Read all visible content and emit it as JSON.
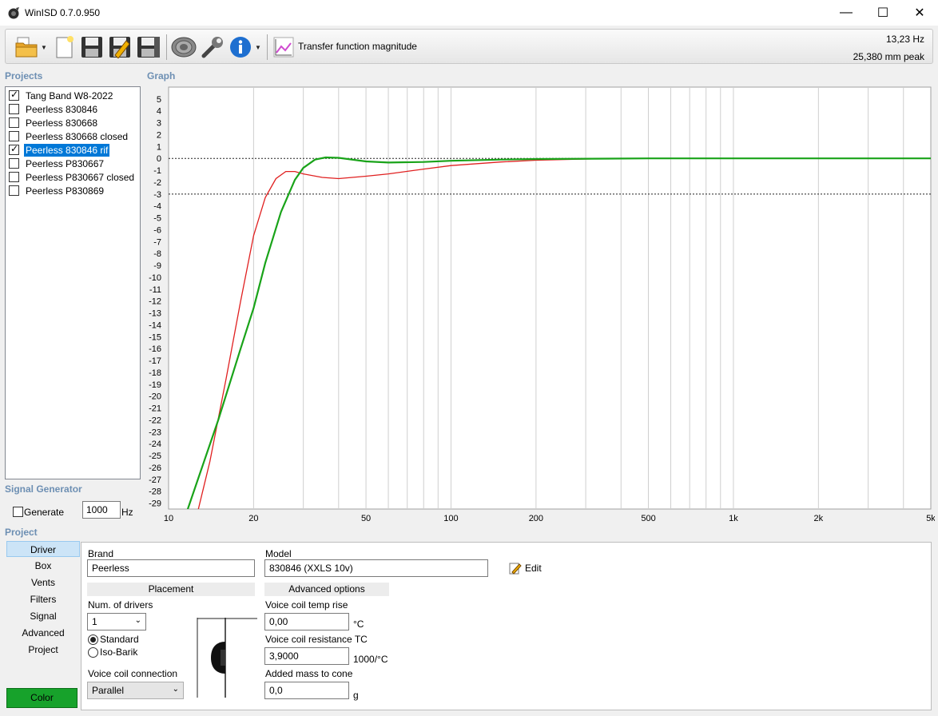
{
  "window": {
    "title": "WinISD 0.7.0.950",
    "minimize_glyph": "—",
    "maximize_glyph": "☐",
    "close_glyph": "✕"
  },
  "toolbar": {
    "icons": [
      "open-folder-icon",
      "new-document-icon",
      "save-icon",
      "save-as-icon",
      "save-all-icon",
      "driver-icon",
      "wrench-icon",
      "info-icon"
    ],
    "mode_icon": "chart-icon",
    "mode_label": "Transfer function magnitude",
    "cursor_frequency": "13,23 Hz",
    "cursor_excursion": "25,380 mm peak"
  },
  "projects": {
    "label": "Projects",
    "items": [
      {
        "name": "Tang Band W8-2022",
        "checked": true,
        "selected": false
      },
      {
        "name": "Peerless 830846",
        "checked": false,
        "selected": false
      },
      {
        "name": "Peerless 830668",
        "checked": false,
        "selected": false
      },
      {
        "name": "Peerless 830668 closed",
        "checked": false,
        "selected": false
      },
      {
        "name": "Peerless 830846 rif",
        "checked": true,
        "selected": true
      },
      {
        "name": "Peerless P830667",
        "checked": false,
        "selected": false
      },
      {
        "name": "Peerless P830667 closed",
        "checked": false,
        "selected": false
      },
      {
        "name": "Peerless P830869",
        "checked": false,
        "selected": false
      }
    ]
  },
  "signal_generator": {
    "label": "Signal Generator",
    "generate_label": "Generate",
    "generate_checked": false,
    "frequency": "1000",
    "unit": "Hz"
  },
  "graph": {
    "label": "Graph"
  },
  "chart_data": {
    "type": "line",
    "xscale": "log",
    "xlim": [
      10,
      5000
    ],
    "ylim": [
      -29.5,
      6
    ],
    "x_tick_labels": [
      "10",
      "20",
      "50",
      "100",
      "200",
      "500",
      "1k",
      "2k",
      "5k"
    ],
    "x_tick_values": [
      10,
      20,
      50,
      100,
      200,
      500,
      1000,
      2000,
      5000
    ],
    "y_tick_values": [
      5,
      4,
      3,
      2,
      1,
      0,
      -1,
      -2,
      -3,
      -4,
      -5,
      -6,
      -7,
      -8,
      -9,
      -10,
      -11,
      -12,
      -13,
      -14,
      -15,
      -16,
      -17,
      -18,
      -19,
      -20,
      -21,
      -22,
      -23,
      -24,
      -25,
      -26,
      -27,
      -28,
      -29
    ],
    "reference_lines": [
      0,
      -3
    ],
    "grid": true,
    "series": [
      {
        "color": "#e02020",
        "x": [
          12.6,
          14,
          16,
          18,
          20,
          22,
          24,
          26,
          28,
          30,
          35,
          40,
          50,
          60,
          80,
          100,
          150,
          200,
          300,
          400
        ],
        "y": [
          -30,
          -25.5,
          -18.5,
          -12,
          -6.5,
          -3.3,
          -1.7,
          -1.1,
          -1.1,
          -1.3,
          -1.6,
          -1.7,
          -1.5,
          -1.3,
          -0.9,
          -0.6,
          -0.3,
          -0.15,
          -0.05,
          0.0
        ]
      },
      {
        "color": "#19a319",
        "x": [
          11.5,
          13,
          15,
          18,
          20,
          22,
          25,
          28,
          30,
          33,
          36,
          40,
          50,
          60,
          80,
          100,
          150,
          200,
          500,
          1000,
          2000,
          5000
        ],
        "y": [
          -30,
          -26.3,
          -22,
          -16,
          -12.6,
          -8.8,
          -4.5,
          -1.8,
          -0.8,
          -0.1,
          0.08,
          0.05,
          -0.25,
          -0.35,
          -0.3,
          -0.2,
          -0.1,
          -0.05,
          0.0,
          0.0,
          0.0,
          0.0
        ]
      }
    ]
  },
  "project_panel": {
    "label": "Project",
    "nav": [
      "Driver",
      "Box",
      "Vents",
      "Filters",
      "Signal",
      "Advanced",
      "Project"
    ],
    "active_nav": 0,
    "color_button": "Color",
    "driver": {
      "brand_label": "Brand",
      "brand": "Peerless",
      "model_label": "Model",
      "model": "830846 (XXLS 10v)",
      "edit_label": "Edit",
      "placement_header": "Placement",
      "num_drivers_label": "Num. of drivers",
      "num_drivers": "1",
      "standard_label": "Standard",
      "isobarik_label": "Iso-Barik",
      "voice_coil_connection_label": "Voice coil connection",
      "voice_coil_connection": "Parallel",
      "advanced_header": "Advanced options",
      "vc_temp_rise_label": "Voice coil temp rise",
      "vc_temp_rise": "0,00",
      "vc_temp_unit": "°C",
      "vc_res_tc_label": "Voice coil resistance TC",
      "vc_res_tc": "3,9000",
      "vc_res_tc_unit": "1000/°C",
      "added_mass_label": "Added mass to cone",
      "added_mass": "0,0",
      "added_mass_unit": "g"
    }
  }
}
